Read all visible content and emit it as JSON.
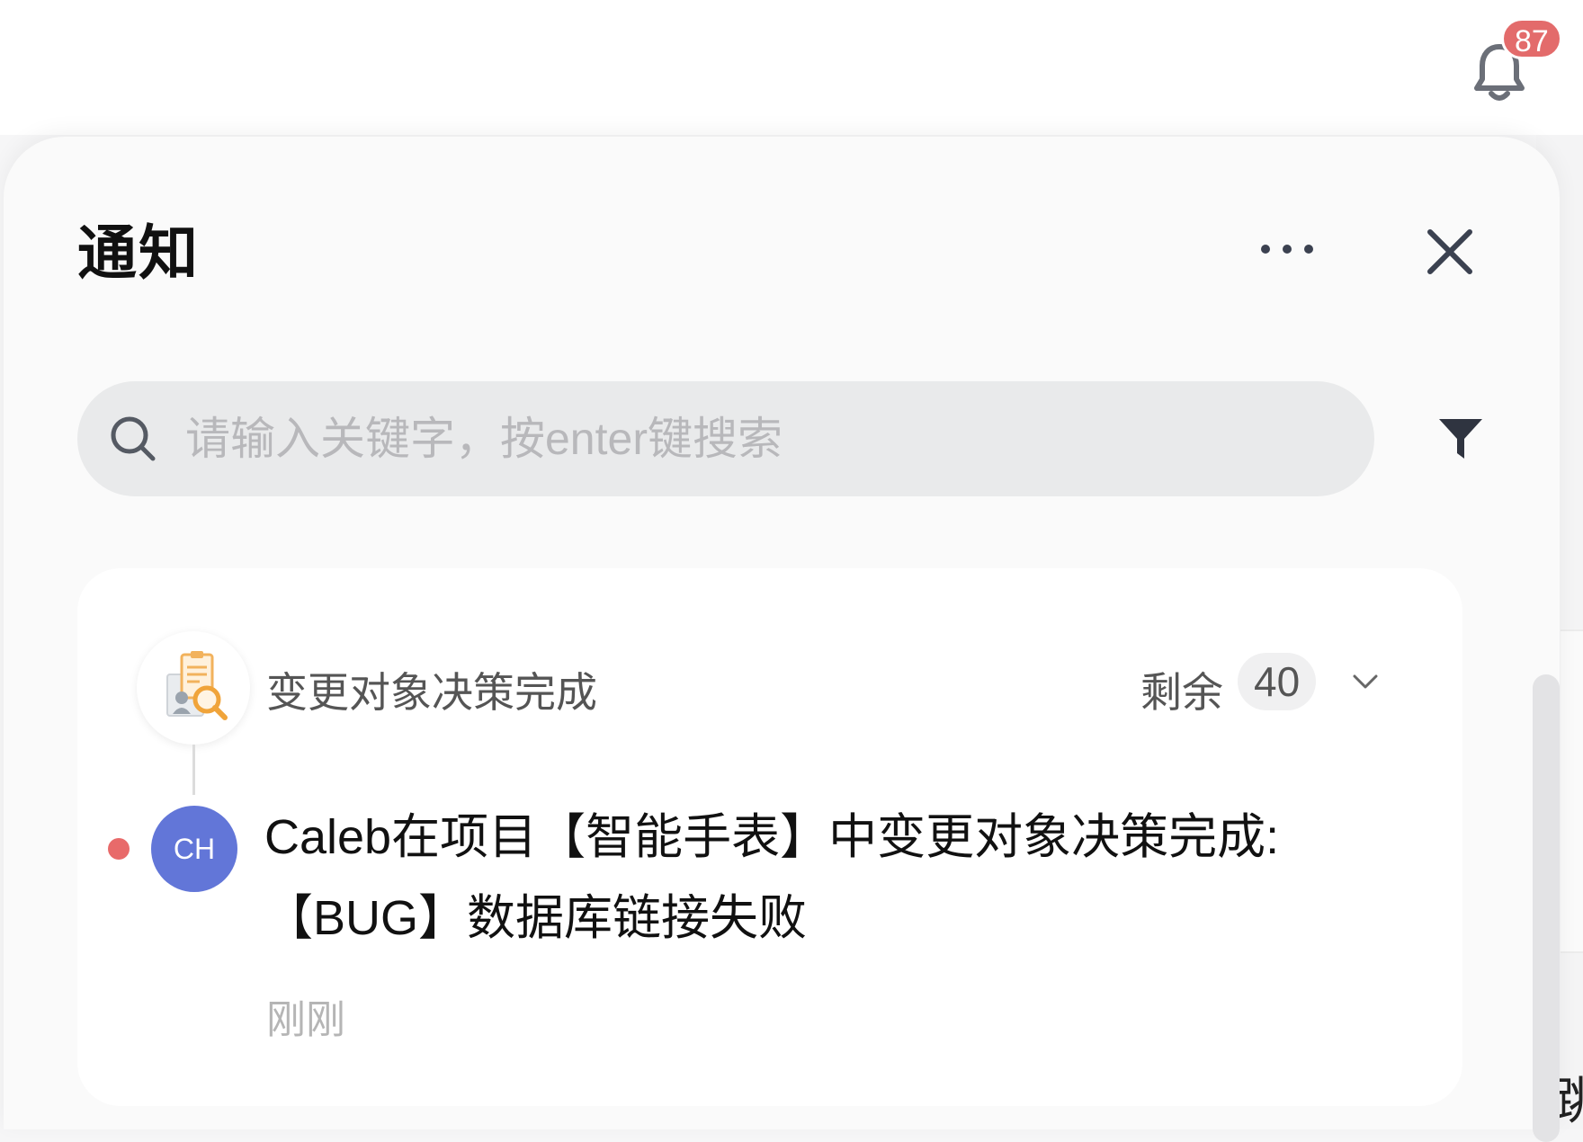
{
  "topbar": {
    "badge_count": "87"
  },
  "panel": {
    "title": "通知"
  },
  "search": {
    "placeholder": "请输入关键字，按enter键搜索"
  },
  "group": {
    "title": "变更对象决策完成",
    "remaining_label": "剩余",
    "remaining_count": "40"
  },
  "notification": {
    "avatar_initials": "CH",
    "message": "Caleb在项目【智能手表】中变更对象决策完成:【BUG】数据库链接失败",
    "time": "刚刚",
    "unread": true
  },
  "background": {
    "right_edge_char": "跳"
  },
  "colors": {
    "badge": "#e36b6b",
    "avatar": "#6276d8",
    "unread_dot": "#e86a6a"
  }
}
